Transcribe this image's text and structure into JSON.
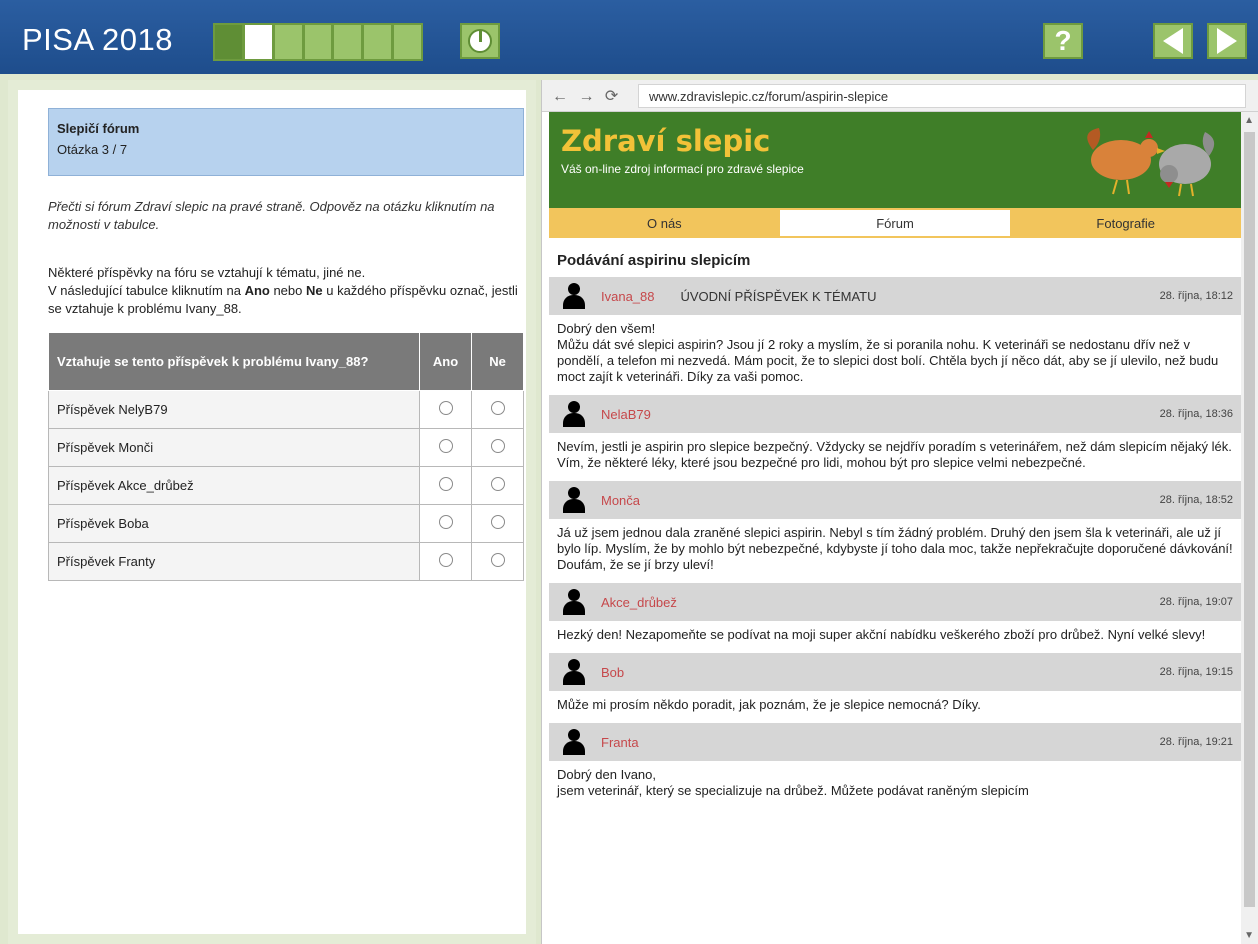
{
  "app": {
    "title": "PISA 2018",
    "help_label": "?",
    "progress": {
      "segments": 7,
      "done": 1,
      "current": 2
    }
  },
  "unit": {
    "title": "Slepičí fórum",
    "question": "Otázka 3 / 7"
  },
  "instructions": "Přečti si fórum Zdraví slepic na pravé straně. Odpověz na otázku kliknutím na možnosti v tabulce.",
  "task": {
    "line1": "Některé příspěvky na fóru se vztahují k tématu, jiné ne.",
    "line2_pre": "V následující tabulce kliknutím na ",
    "yes_bold": "Ano",
    "line2_mid": " nebo ",
    "no_bold": "Ne",
    "line2_post": " u každého příspěvku označ, jestli se vztahuje k problému Ivany_88."
  },
  "answer_table": {
    "header": "Vztahuje se tento příspěvek k problému Ivany_88?",
    "yes": "Ano",
    "no": "Ne",
    "rows": [
      "Příspěvek NelyB79",
      "Příspěvek Monči",
      "Příspěvek Akce_drůbež",
      "Příspěvek Boba",
      "Příspěvek Franty"
    ]
  },
  "browser": {
    "nav_icons": "← → ⟳",
    "url": "www.zdravislepic.cz/forum/aspirin-slepice"
  },
  "site": {
    "title": "Zdraví slepic",
    "subtitle": "Váš on-line zdroj informací pro zdravé slepice",
    "nav": [
      "O nás",
      "Fórum",
      "Fotografie"
    ],
    "thread_title": "Podávání aspirinu slepicím"
  },
  "posts": [
    {
      "user": "Ivana_88",
      "topic": "ÚVODNÍ PŘÍSPĚVEK K TÉMATU",
      "date": "28. října, 18:12",
      "lines": [
        "Dobrý den všem!",
        "Můžu dát své slepici aspirin? Jsou jí 2 roky a myslím, že si poranila nohu. K veterináři se nedostanu dřív než v pondělí, a telefon mi nezvedá. Mám pocit, že to slepici dost bolí. Chtěla bych jí něco dát, aby se jí ulevilo, než budu moct zajít k veterináři. Díky za vaši pomoc."
      ]
    },
    {
      "user": "NelaB79",
      "topic": "",
      "date": "28. října, 18:36",
      "lines": [
        "Nevím, jestli je aspirin pro slepice bezpečný. Vždycky se nejdřív poradím s veterinářem, než dám slepicím nějaký lék. Vím, že některé léky, které jsou bezpečné pro lidi, mohou být pro slepice velmi nebezpečné."
      ]
    },
    {
      "user": "Monča",
      "topic": "",
      "date": "28. října, 18:52",
      "lines": [
        "Já už jsem jednou dala zraněné slepici aspirin. Nebyl s tím žádný problém. Druhý den jsem šla k veterináři, ale už jí bylo líp. Myslím, že by mohlo být nebezpečné, kdybyste jí toho dala moc, takže nepřekračujte doporučené dávkování! Doufám, že se jí brzy uleví!"
      ]
    },
    {
      "user": "Akce_drůbež",
      "topic": "",
      "date": "28. října, 19:07",
      "lines": [
        "Hezký den! Nezapomeňte se podívat na moji super akční nabídku veškerého zboží pro drůbež. Nyní velké slevy!"
      ]
    },
    {
      "user": "Bob",
      "topic": "",
      "date": "28. října, 19:15",
      "lines": [
        "Může mi prosím někdo poradit, jak poznám, že je slepice nemocná? Díky."
      ]
    },
    {
      "user": "Franta",
      "topic": "",
      "date": "28. října, 19:21",
      "lines": [
        "Dobrý den Ivano,",
        "jsem veterinář, který se specializuje na drůbež. Můžete podávat raněným slepicím"
      ]
    }
  ],
  "colors": {
    "topbar": "#1e4d8c",
    "progress_green": "#9bc46b",
    "site_header": "#3f7e28",
    "site_title": "#f2c238",
    "nav_bar": "#f2c55c",
    "username": "#c6484b"
  }
}
